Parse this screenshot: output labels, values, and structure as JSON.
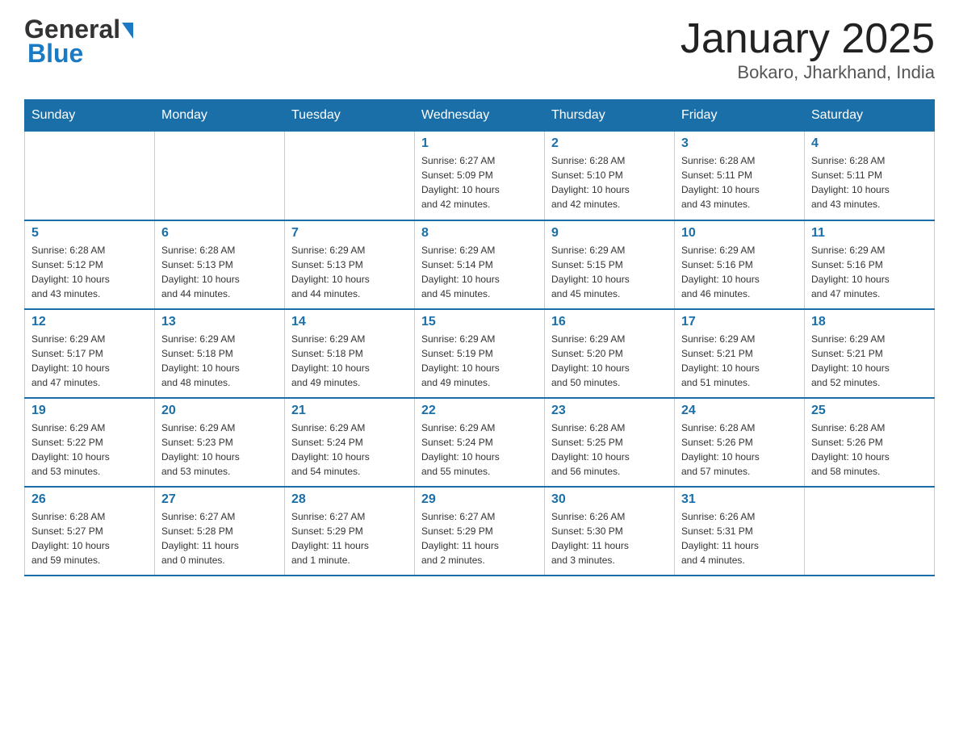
{
  "logo": {
    "general": "General",
    "blue": "Blue"
  },
  "title": "January 2025",
  "subtitle": "Bokaro, Jharkhand, India",
  "days": [
    "Sunday",
    "Monday",
    "Tuesday",
    "Wednesday",
    "Thursday",
    "Friday",
    "Saturday"
  ],
  "weeks": [
    [
      {
        "day": "",
        "info": ""
      },
      {
        "day": "",
        "info": ""
      },
      {
        "day": "",
        "info": ""
      },
      {
        "day": "1",
        "info": "Sunrise: 6:27 AM\nSunset: 5:09 PM\nDaylight: 10 hours\nand 42 minutes."
      },
      {
        "day": "2",
        "info": "Sunrise: 6:28 AM\nSunset: 5:10 PM\nDaylight: 10 hours\nand 42 minutes."
      },
      {
        "day": "3",
        "info": "Sunrise: 6:28 AM\nSunset: 5:11 PM\nDaylight: 10 hours\nand 43 minutes."
      },
      {
        "day": "4",
        "info": "Sunrise: 6:28 AM\nSunset: 5:11 PM\nDaylight: 10 hours\nand 43 minutes."
      }
    ],
    [
      {
        "day": "5",
        "info": "Sunrise: 6:28 AM\nSunset: 5:12 PM\nDaylight: 10 hours\nand 43 minutes."
      },
      {
        "day": "6",
        "info": "Sunrise: 6:28 AM\nSunset: 5:13 PM\nDaylight: 10 hours\nand 44 minutes."
      },
      {
        "day": "7",
        "info": "Sunrise: 6:29 AM\nSunset: 5:13 PM\nDaylight: 10 hours\nand 44 minutes."
      },
      {
        "day": "8",
        "info": "Sunrise: 6:29 AM\nSunset: 5:14 PM\nDaylight: 10 hours\nand 45 minutes."
      },
      {
        "day": "9",
        "info": "Sunrise: 6:29 AM\nSunset: 5:15 PM\nDaylight: 10 hours\nand 45 minutes."
      },
      {
        "day": "10",
        "info": "Sunrise: 6:29 AM\nSunset: 5:16 PM\nDaylight: 10 hours\nand 46 minutes."
      },
      {
        "day": "11",
        "info": "Sunrise: 6:29 AM\nSunset: 5:16 PM\nDaylight: 10 hours\nand 47 minutes."
      }
    ],
    [
      {
        "day": "12",
        "info": "Sunrise: 6:29 AM\nSunset: 5:17 PM\nDaylight: 10 hours\nand 47 minutes."
      },
      {
        "day": "13",
        "info": "Sunrise: 6:29 AM\nSunset: 5:18 PM\nDaylight: 10 hours\nand 48 minutes."
      },
      {
        "day": "14",
        "info": "Sunrise: 6:29 AM\nSunset: 5:18 PM\nDaylight: 10 hours\nand 49 minutes."
      },
      {
        "day": "15",
        "info": "Sunrise: 6:29 AM\nSunset: 5:19 PM\nDaylight: 10 hours\nand 49 minutes."
      },
      {
        "day": "16",
        "info": "Sunrise: 6:29 AM\nSunset: 5:20 PM\nDaylight: 10 hours\nand 50 minutes."
      },
      {
        "day": "17",
        "info": "Sunrise: 6:29 AM\nSunset: 5:21 PM\nDaylight: 10 hours\nand 51 minutes."
      },
      {
        "day": "18",
        "info": "Sunrise: 6:29 AM\nSunset: 5:21 PM\nDaylight: 10 hours\nand 52 minutes."
      }
    ],
    [
      {
        "day": "19",
        "info": "Sunrise: 6:29 AM\nSunset: 5:22 PM\nDaylight: 10 hours\nand 53 minutes."
      },
      {
        "day": "20",
        "info": "Sunrise: 6:29 AM\nSunset: 5:23 PM\nDaylight: 10 hours\nand 53 minutes."
      },
      {
        "day": "21",
        "info": "Sunrise: 6:29 AM\nSunset: 5:24 PM\nDaylight: 10 hours\nand 54 minutes."
      },
      {
        "day": "22",
        "info": "Sunrise: 6:29 AM\nSunset: 5:24 PM\nDaylight: 10 hours\nand 55 minutes."
      },
      {
        "day": "23",
        "info": "Sunrise: 6:28 AM\nSunset: 5:25 PM\nDaylight: 10 hours\nand 56 minutes."
      },
      {
        "day": "24",
        "info": "Sunrise: 6:28 AM\nSunset: 5:26 PM\nDaylight: 10 hours\nand 57 minutes."
      },
      {
        "day": "25",
        "info": "Sunrise: 6:28 AM\nSunset: 5:26 PM\nDaylight: 10 hours\nand 58 minutes."
      }
    ],
    [
      {
        "day": "26",
        "info": "Sunrise: 6:28 AM\nSunset: 5:27 PM\nDaylight: 10 hours\nand 59 minutes."
      },
      {
        "day": "27",
        "info": "Sunrise: 6:27 AM\nSunset: 5:28 PM\nDaylight: 11 hours\nand 0 minutes."
      },
      {
        "day": "28",
        "info": "Sunrise: 6:27 AM\nSunset: 5:29 PM\nDaylight: 11 hours\nand 1 minute."
      },
      {
        "day": "29",
        "info": "Sunrise: 6:27 AM\nSunset: 5:29 PM\nDaylight: 11 hours\nand 2 minutes."
      },
      {
        "day": "30",
        "info": "Sunrise: 6:26 AM\nSunset: 5:30 PM\nDaylight: 11 hours\nand 3 minutes."
      },
      {
        "day": "31",
        "info": "Sunrise: 6:26 AM\nSunset: 5:31 PM\nDaylight: 11 hours\nand 4 minutes."
      },
      {
        "day": "",
        "info": ""
      }
    ]
  ]
}
